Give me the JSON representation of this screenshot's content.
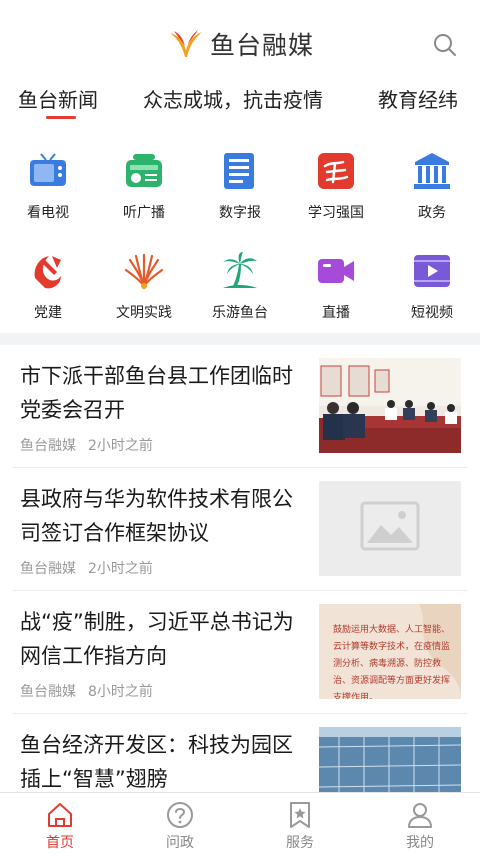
{
  "header": {
    "brand": "鱼台融媒"
  },
  "tabs": [
    {
      "label": "鱼台新闻",
      "active": true
    },
    {
      "label": "众志成城，抗击疫情"
    },
    {
      "label": "教育经纬"
    }
  ],
  "grid": [
    {
      "label": "看电视",
      "icon": "tv-icon"
    },
    {
      "label": "听广播",
      "icon": "radio-icon"
    },
    {
      "label": "数字报",
      "icon": "newspaper-icon"
    },
    {
      "label": "学习强国",
      "icon": "xuexi-icon"
    },
    {
      "label": "政务",
      "icon": "government-building-icon"
    },
    {
      "label": "党建",
      "icon": "party-emblem-icon"
    },
    {
      "label": "文明实践",
      "icon": "civilization-practice-icon"
    },
    {
      "label": "乐游鱼台",
      "icon": "palm-tree-icon"
    },
    {
      "label": "直播",
      "icon": "live-camera-icon"
    },
    {
      "label": "短视频",
      "icon": "short-video-icon"
    }
  ],
  "news": [
    {
      "title": "市下派干部鱼台县工作团临时党委会召开",
      "source": "鱼台融媒",
      "time": "2小时之前",
      "thumb": "meeting-photo"
    },
    {
      "title": "县政府与华为软件技术有限公司签订合作框架协议",
      "source": "鱼台融媒",
      "time": "2小时之前",
      "thumb": "placeholder-image"
    },
    {
      "title": "战“疫”制胜，习近平总书记为网信工作指方向",
      "source": "鱼台融媒",
      "time": "8小时之前",
      "thumb": "quote-card"
    },
    {
      "title": "鱼台经济开发区：科技为园区插上“智慧”翅膀",
      "source": "",
      "time": "",
      "thumb": "building-photo"
    }
  ],
  "thumb_quote": "鼓励运用大数据、人工智能、云计算等数字技术，在疫情监测分析、病毒溯源、防控救治、资源调配等方面更好发挥支撑作用。",
  "bottom_nav": [
    {
      "label": "首页",
      "icon": "home-icon",
      "active": true
    },
    {
      "label": "问政",
      "icon": "question-icon"
    },
    {
      "label": "服务",
      "icon": "star-bookmark-icon"
    },
    {
      "label": "我的",
      "icon": "user-icon"
    }
  ],
  "colors": {
    "accent": "#e33a32",
    "tab_underline": "#e33a32"
  }
}
